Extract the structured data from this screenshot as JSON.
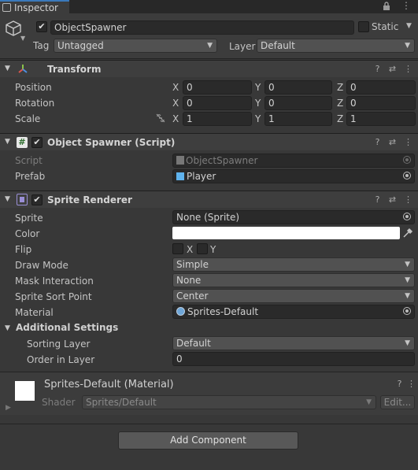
{
  "tab": {
    "label": "Inspector"
  },
  "object": {
    "name": "ObjectSpawner",
    "active": true,
    "static_label": "Static",
    "tag_label": "Tag",
    "tag_value": "Untagged",
    "layer_label": "Layer",
    "layer_value": "Default"
  },
  "transform": {
    "title": "Transform",
    "rows": [
      {
        "label": "Position",
        "x": "0",
        "y": "0",
        "z": "0"
      },
      {
        "label": "Rotation",
        "x": "0",
        "y": "0",
        "z": "0"
      },
      {
        "label": "Scale",
        "x": "1",
        "y": "1",
        "z": "1"
      }
    ],
    "axis": {
      "x": "X",
      "y": "Y",
      "z": "Z"
    }
  },
  "spawner": {
    "title": "Object Spawner (Script)",
    "enabled": true,
    "script_label": "Script",
    "script_value": "ObjectSpawner",
    "prefab_label": "Prefab",
    "prefab_value": "Player"
  },
  "sprite_renderer": {
    "title": "Sprite Renderer",
    "enabled": true,
    "sprite_label": "Sprite",
    "sprite_value": "None (Sprite)",
    "color_label": "Color",
    "color_value": "#ffffff",
    "flip_label": "Flip",
    "flip_x": "X",
    "flip_y": "Y",
    "draw_mode_label": "Draw Mode",
    "draw_mode_value": "Simple",
    "mask_label": "Mask Interaction",
    "mask_value": "None",
    "sort_point_label": "Sprite Sort Point",
    "sort_point_value": "Center",
    "material_label": "Material",
    "material_value": "Sprites-Default",
    "additional_label": "Additional Settings",
    "sorting_layer_label": "Sorting Layer",
    "sorting_layer_value": "Default",
    "order_label": "Order in Layer",
    "order_value": "0"
  },
  "material": {
    "title": "Sprites-Default (Material)",
    "shader_label": "Shader",
    "shader_value": "Sprites/Default",
    "edit_label": "Edit..."
  },
  "add_component": {
    "label": "Add Component"
  }
}
